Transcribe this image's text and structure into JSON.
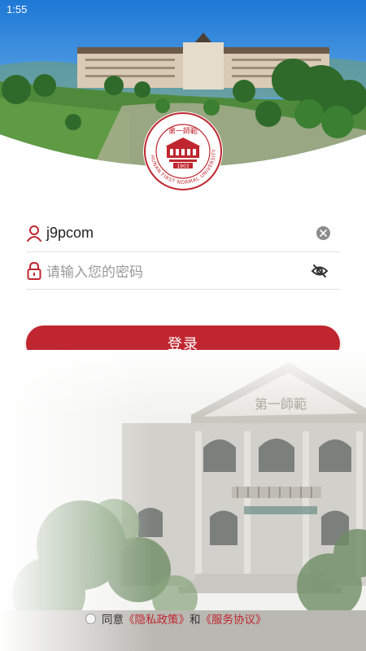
{
  "status_bar": {
    "time": "1:55"
  },
  "emblem": {
    "calligraphy": "第一師範",
    "year": "1903",
    "ring_text": "HUNAN FIRST NORMAL UNIVERSITY"
  },
  "login_form": {
    "username_value": "j9pcom",
    "password_placeholder": "请输入您的密码",
    "submit_label": "登录"
  },
  "agreement": {
    "prefix": "同意",
    "privacy_link": "《隐私政策》",
    "connector": "和",
    "service_link": "《服务协议》"
  },
  "colors": {
    "brand_red": "#c0262f",
    "sky_blue": "#3d9be6"
  },
  "icons": [
    "person-icon",
    "lock-icon",
    "clear-icon",
    "eye-off-icon"
  ]
}
